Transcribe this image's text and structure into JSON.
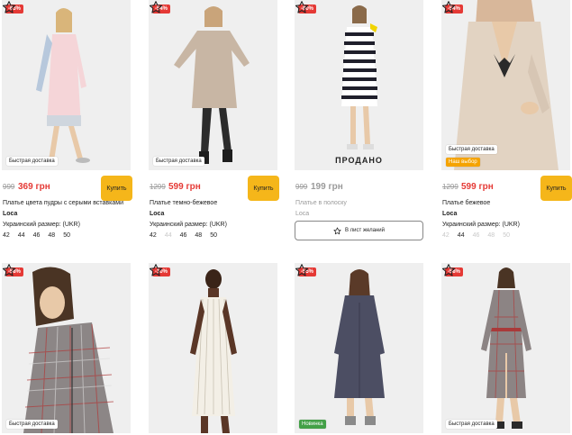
{
  "colors": {
    "discount": "#e53935",
    "buy": "#f5b61a",
    "price": "#e53935"
  },
  "row1": [
    {
      "discount": "-63%",
      "badges": [
        "Быстрая доставка"
      ],
      "old_price": "999",
      "new_price": "369 грн",
      "buy_label": "Купить",
      "name": "Платье цвета пудры с серыми вставками",
      "brand": "Loca",
      "size_label": "Украинский размер: (UKR)",
      "sizes": [
        "42",
        "44",
        "46",
        "48",
        "50"
      ]
    },
    {
      "discount": "-54%",
      "badges": [
        "Быстрая доставка"
      ],
      "old_price": "1299",
      "new_price": "599 грн",
      "buy_label": "Купить",
      "name": "Платье темно-бежевое",
      "brand": "Loca",
      "size_label": "Украинский размер: (UKR)",
      "sizes": [
        "42",
        "44",
        "46",
        "48",
        "50"
      ]
    },
    {
      "discount": "-80%",
      "sold_label": "ПРОДАНО",
      "old_price": "999",
      "new_price": "199 грн",
      "name": "Платье в полоску",
      "brand": "Loca",
      "wish_label": "В лист желаний"
    },
    {
      "discount": "-54%",
      "badges": [
        "Быстрая доставка",
        "Наш выбор"
      ],
      "old_price": "1299",
      "new_price": "599 грн",
      "buy_label": "Купить",
      "name": "Платье бежевое",
      "brand": "Loca",
      "size_label": "Украинский размер: (UKR)",
      "sizes": [
        "42",
        "44",
        "46",
        "48",
        "50"
      ]
    }
  ],
  "row2": [
    {
      "discount": "-58%",
      "badge": "Быстрая доставка"
    },
    {
      "discount": "-10%",
      "badge": ""
    },
    {
      "discount": "-55%",
      "badge": "Новинка"
    },
    {
      "discount": "-58%",
      "badge": "Быстрая доставка"
    }
  ]
}
